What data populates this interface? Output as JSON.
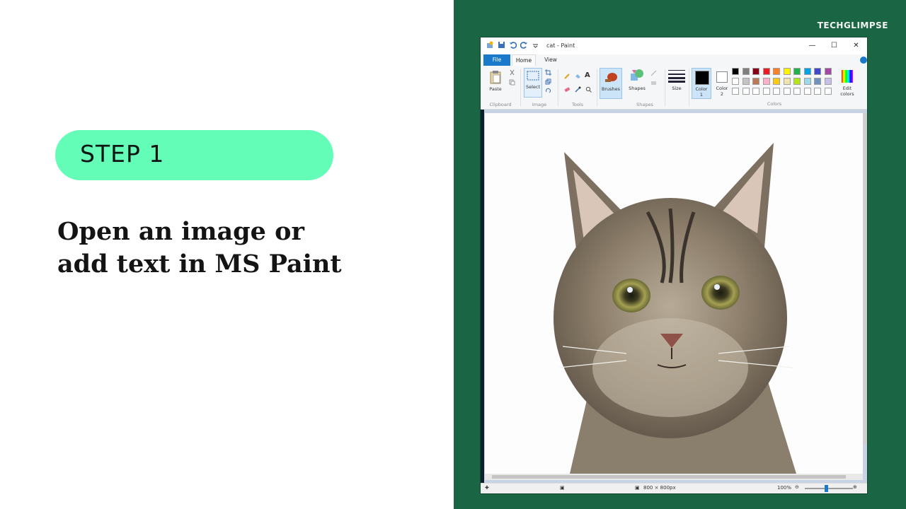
{
  "slide": {
    "step_label": "STEP 1",
    "headline_line1": "Open an image or",
    "headline_line2": "add text in MS Paint"
  },
  "brand": {
    "name": "TECHGLIMPSE"
  },
  "paint": {
    "window_title": "cat - Paint",
    "tabs": {
      "file": "File",
      "home": "Home",
      "view": "View"
    },
    "ribbon": {
      "clipboard": {
        "paste": "Paste",
        "group": "Clipboard"
      },
      "image": {
        "select": "Select",
        "group": "Image"
      },
      "tools": {
        "group": "Tools",
        "text_tool": "A"
      },
      "brushes": {
        "label": "Brushes"
      },
      "shapes": {
        "label": "Shapes",
        "group": "Shapes"
      },
      "size": {
        "label": "Size"
      },
      "color1": {
        "label_line1": "Color",
        "label_line2": "1"
      },
      "color2": {
        "label_line1": "Color",
        "label_line2": "2"
      },
      "colors": {
        "group": "Colors",
        "edit_line1": "Edit",
        "edit_line2": "colors"
      },
      "palette_row1": [
        "#000000",
        "#7f7f7f",
        "#880015",
        "#ed1c24",
        "#ff7f27",
        "#fff200",
        "#22b14c",
        "#00a2e8",
        "#3f48cc",
        "#a349a4"
      ],
      "palette_row2": [
        "#ffffff",
        "#c3c3c3",
        "#b97a57",
        "#ffaec9",
        "#ffc90e",
        "#efe4b0",
        "#b5e61d",
        "#99d9ea",
        "#7092be",
        "#c8bfe7"
      ]
    },
    "status": {
      "dimensions": "800 × 800px",
      "zoom": "100%"
    },
    "colors": {
      "accent": "#1979ca",
      "step_pill": "#63fdb8",
      "slide_bg_green": "#1a6544"
    },
    "canvas_image": "cat photograph"
  }
}
